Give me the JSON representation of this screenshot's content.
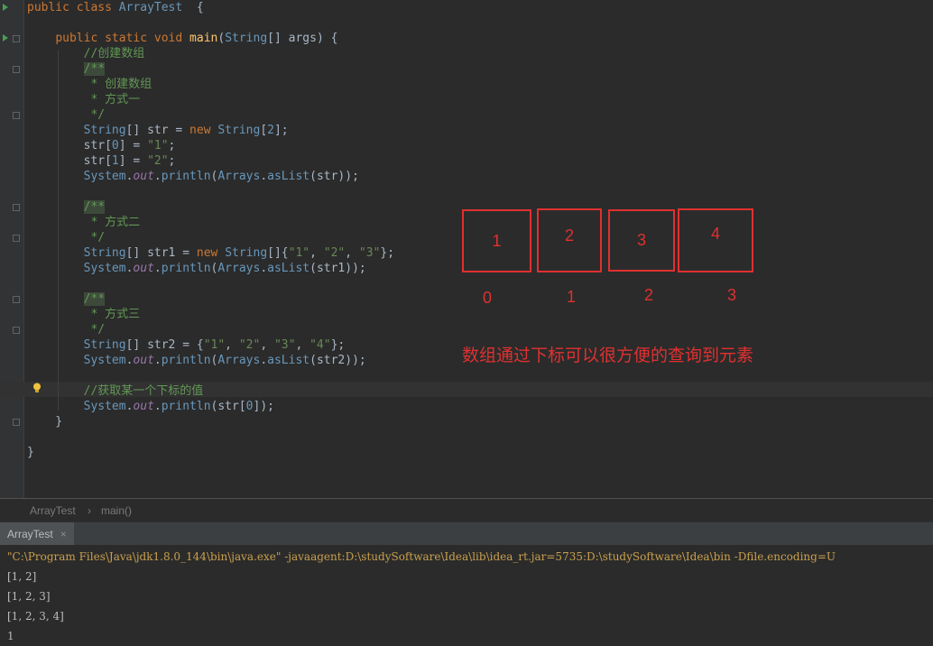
{
  "code_lines": [
    {
      "tokens": [
        [
          "kw",
          "public "
        ],
        [
          "kw",
          "class "
        ],
        [
          "cls",
          "ArrayTest"
        ],
        [
          "",
          "  {"
        ]
      ]
    },
    {
      "tokens": []
    },
    {
      "tokens": [
        [
          "",
          "    "
        ],
        [
          "kw",
          "public "
        ],
        [
          "kw",
          "static "
        ],
        [
          "kw",
          "void "
        ],
        [
          "fn",
          "main"
        ],
        [
          "",
          "("
        ],
        [
          "cls",
          "String"
        ],
        [
          "",
          "[] args) {"
        ]
      ]
    },
    {
      "tokens": [
        [
          "",
          "        "
        ],
        [
          "cmt",
          "//创建数组"
        ]
      ]
    },
    {
      "tokens": [
        [
          "",
          "        "
        ],
        [
          "cmt hl",
          "/**"
        ]
      ]
    },
    {
      "tokens": [
        [
          "",
          "        "
        ],
        [
          "cmt",
          " * 创建数组"
        ]
      ]
    },
    {
      "tokens": [
        [
          "",
          "        "
        ],
        [
          "cmt",
          " * 方式一"
        ]
      ]
    },
    {
      "tokens": [
        [
          "",
          "        "
        ],
        [
          "cmt",
          " */"
        ]
      ]
    },
    {
      "tokens": [
        [
          "",
          "        "
        ],
        [
          "cls",
          "String"
        ],
        [
          "",
          "[] str = "
        ],
        [
          "kw",
          "new "
        ],
        [
          "cls",
          "String"
        ],
        [
          "",
          "["
        ],
        [
          "num",
          "2"
        ],
        [
          "",
          "];"
        ]
      ]
    },
    {
      "tokens": [
        [
          "",
          "        str["
        ],
        [
          "num",
          "0"
        ],
        [
          "",
          "] = "
        ],
        [
          "str",
          "\"1\""
        ],
        [
          "",
          ";"
        ]
      ]
    },
    {
      "tokens": [
        [
          "",
          "        str["
        ],
        [
          "num",
          "1"
        ],
        [
          "",
          "] = "
        ],
        [
          "str",
          "\"2\""
        ],
        [
          "",
          ";"
        ]
      ]
    },
    {
      "tokens": [
        [
          "",
          "        "
        ],
        [
          "cls",
          "System"
        ],
        [
          "",
          "."
        ],
        [
          "field",
          "out"
        ],
        [
          "",
          "."
        ],
        [
          "cls",
          "println"
        ],
        [
          "",
          "("
        ],
        [
          "cls",
          "Arrays"
        ],
        [
          "",
          "."
        ],
        [
          "cls",
          "asList"
        ],
        [
          "",
          "(str));"
        ]
      ]
    },
    {
      "tokens": []
    },
    {
      "tokens": [
        [
          "",
          "        "
        ],
        [
          "cmt hl",
          "/**"
        ]
      ]
    },
    {
      "tokens": [
        [
          "",
          "        "
        ],
        [
          "cmt",
          " * 方式二"
        ]
      ]
    },
    {
      "tokens": [
        [
          "",
          "        "
        ],
        [
          "cmt",
          " */"
        ]
      ]
    },
    {
      "tokens": [
        [
          "",
          "        "
        ],
        [
          "cls",
          "String"
        ],
        [
          "",
          "[] str1 = "
        ],
        [
          "kw",
          "new "
        ],
        [
          "cls",
          "String"
        ],
        [
          "",
          "[]{"
        ],
        [
          "str",
          "\"1\""
        ],
        [
          "",
          ", "
        ],
        [
          "str",
          "\"2\""
        ],
        [
          "",
          ", "
        ],
        [
          "str",
          "\"3\""
        ],
        [
          "",
          "};"
        ]
      ]
    },
    {
      "tokens": [
        [
          "",
          "        "
        ],
        [
          "cls",
          "System"
        ],
        [
          "",
          "."
        ],
        [
          "field",
          "out"
        ],
        [
          "",
          "."
        ],
        [
          "cls",
          "println"
        ],
        [
          "",
          "("
        ],
        [
          "cls",
          "Arrays"
        ],
        [
          "",
          "."
        ],
        [
          "cls",
          "asList"
        ],
        [
          "",
          "(str1));"
        ]
      ]
    },
    {
      "tokens": []
    },
    {
      "tokens": [
        [
          "",
          "        "
        ],
        [
          "cmt hl",
          "/**"
        ]
      ]
    },
    {
      "tokens": [
        [
          "",
          "        "
        ],
        [
          "cmt",
          " * 方式三"
        ]
      ]
    },
    {
      "tokens": [
        [
          "",
          "        "
        ],
        [
          "cmt",
          " */"
        ]
      ]
    },
    {
      "tokens": [
        [
          "",
          "        "
        ],
        [
          "cls",
          "String"
        ],
        [
          "",
          "[] str2 = {"
        ],
        [
          "str",
          "\"1\""
        ],
        [
          "",
          ", "
        ],
        [
          "str",
          "\"2\""
        ],
        [
          "",
          ", "
        ],
        [
          "str",
          "\"3\""
        ],
        [
          "",
          ", "
        ],
        [
          "str",
          "\"4\""
        ],
        [
          "",
          "};"
        ]
      ]
    },
    {
      "tokens": [
        [
          "",
          "        "
        ],
        [
          "cls",
          "System"
        ],
        [
          "",
          "."
        ],
        [
          "field",
          "out"
        ],
        [
          "",
          "."
        ],
        [
          "cls",
          "println"
        ],
        [
          "",
          "("
        ],
        [
          "cls",
          "Arrays"
        ],
        [
          "",
          "."
        ],
        [
          "cls",
          "asList"
        ],
        [
          "",
          "(str2));"
        ]
      ]
    },
    {
      "tokens": []
    },
    {
      "tokens": [
        [
          "",
          "        "
        ],
        [
          "cmt",
          "//获取某一个下标的值"
        ]
      ]
    },
    {
      "tokens": [
        [
          "",
          "        "
        ],
        [
          "cls",
          "System"
        ],
        [
          "",
          "."
        ],
        [
          "field",
          "out"
        ],
        [
          "",
          "."
        ],
        [
          "cls",
          "println"
        ],
        [
          "",
          "(str["
        ],
        [
          "num",
          "0"
        ],
        [
          "",
          "]);"
        ]
      ]
    },
    {
      "tokens": [
        [
          "",
          "    }"
        ]
      ]
    },
    {
      "tokens": []
    },
    {
      "tokens": [
        [
          "",
          "}"
        ]
      ]
    }
  ],
  "annotation": {
    "boxes": [
      "1",
      "2",
      "3",
      "4"
    ],
    "indices": [
      "0",
      "1",
      "2",
      "3"
    ],
    "note": "数组通过下标可以很方便的查询到元素"
  },
  "breadcrumb": {
    "class_name": "ArrayTest",
    "separator": "›",
    "method_name": "main()"
  },
  "console": {
    "tab_label": "ArrayTest",
    "tab_close": "×",
    "lines": [
      "\"C:\\Program Files\\Java\\jdk1.8.0_144\\bin\\java.exe\" -javaagent:D:\\studySoftware\\Idea\\lib\\idea_rt.jar=5735:D:\\studySoftware\\Idea\\bin -Dfile.encoding=U",
      "[1, 2]",
      "[1, 2, 3]",
      "[1, 2, 3, 4]",
      "1"
    ]
  },
  "colors": {
    "annotation_red": "#e03030",
    "editor_bg": "#2b2b2b",
    "keyword": "#cc7832",
    "string": "#6a8759",
    "comment": "#629755"
  }
}
